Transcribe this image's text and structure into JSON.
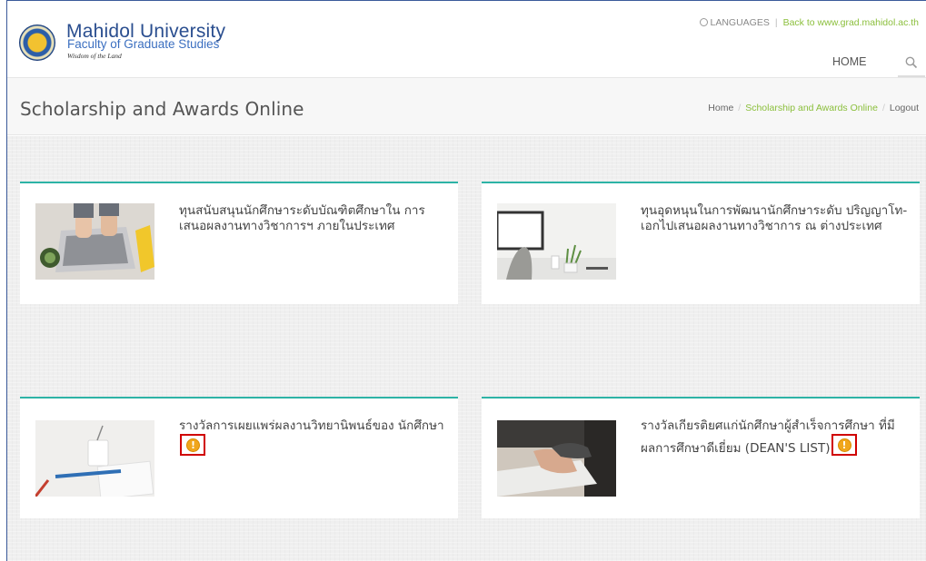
{
  "header": {
    "logo_title": "Mahidol University",
    "logo_sub": "Faculty of Graduate Studies",
    "logo_tagline": "Wisdom of the Land",
    "languages": "LANGUAGES",
    "back_link": "Back to www.grad.mahidol.ac.th",
    "nav_home": "HOME"
  },
  "titlebar": {
    "title": "Scholarship and Awards Online",
    "breadcrumb": {
      "home": "Home",
      "current": "Scholarship and Awards Online",
      "logout": "Logout"
    }
  },
  "cards": [
    {
      "title": "ทุนสนับสนุนนักศึกษาระดับบัณฑิตศึกษาใน การเสนอผลงานทางวิชาการฯ ภายในประเทศ",
      "image": "laptop-hands-image",
      "warning": false
    },
    {
      "title": "ทุนอุดหนุนในการพัฒนานักศึกษาระดับ ปริญญาโท-เอกไปเสนอผลงานทางวิชาการ ณ ต่างประเทศ",
      "image": "desk-monitor-image",
      "warning": false
    },
    {
      "title": "รางวัลการเผยแพร่ผลงานวิทยานิพนธ์ของ นักศึกษา",
      "image": "cup-notebook-image",
      "warning": true
    },
    {
      "title": "รางวัลเกียรติยศแก่นักศึกษาผู้สำเร็จการศึกษา ที่มีผลการศึกษาดีเยี่ยม (DEAN'S LIST)",
      "image": "typing-keyboard-image",
      "warning": true
    }
  ],
  "warning_glyph": "!",
  "colors": {
    "accent": "#2db3a6",
    "link_green": "#8bbf3c",
    "warning": "#f0a61c",
    "highlight_box": "#d00000"
  }
}
